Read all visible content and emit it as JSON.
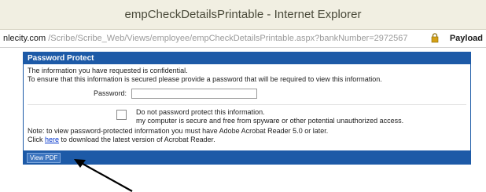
{
  "window": {
    "title": "empCheckDetailsPrintable - Internet Explorer"
  },
  "address_bar": {
    "host": "nlecity.com",
    "path": "/Scribe/Scribe_Web/Views/employee/empCheckDetailsPrintable.aspx?bankNumber=2972567",
    "right_text": "Payload"
  },
  "panel": {
    "header": "Password Protect",
    "line1": "The information you have requested is confidential.",
    "line2": "To ensure that this information is secured please provide a password that will be required to view this information.",
    "password_label": "Password:",
    "password_value": "",
    "checkbox_line1": "Do not password protect this information.",
    "checkbox_line2": "my computer is secure and free from spyware or other potential unauthorized access.",
    "note": "Note: to view password-protected information you must have Adobe Acrobat Reader 5.0 or later.",
    "click_prefix": "Click ",
    "click_link": "here",
    "click_suffix": " to download the latest version of Acrobat Reader.",
    "view_button": "View PDF"
  },
  "icons": {
    "lock": "lock-icon",
    "annotation_arrow": "arrow-icon"
  },
  "colors": {
    "panel_blue": "#1d5aa7",
    "titlebar": "#f1efe2",
    "link": "#0033cc"
  }
}
